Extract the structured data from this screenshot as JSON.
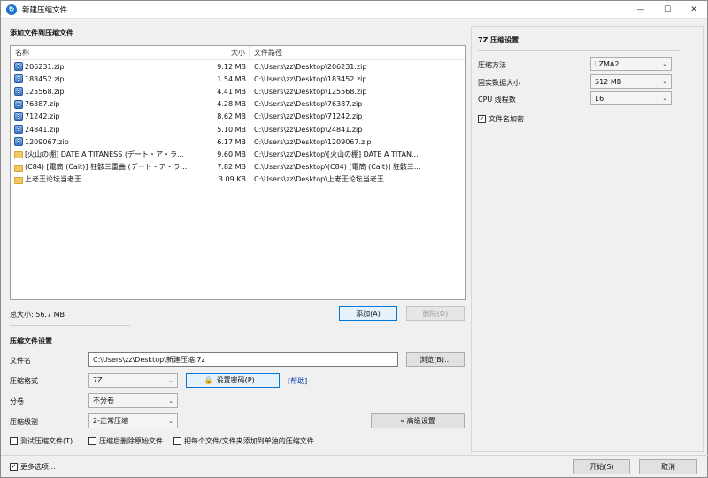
{
  "window": {
    "title": "新建压缩文件",
    "controls": {
      "minimize": "—",
      "maximize": "☐",
      "close": "✕"
    }
  },
  "add_files": {
    "section_title": "添加文件到压缩文件",
    "columns": {
      "name": "名称",
      "size": "大小",
      "path": "文件路径"
    },
    "rows": [
      {
        "icon": "zip-file-icon",
        "name": "206231.zip",
        "size": "9.12 MB",
        "path": "C:\\Users\\zz\\Desktop\\206231.zip"
      },
      {
        "icon": "zip-file-icon",
        "name": "183452.zip",
        "size": "1.54 MB",
        "path": "C:\\Users\\zz\\Desktop\\183452.zip"
      },
      {
        "icon": "zip-file-icon",
        "name": "125568.zip",
        "size": "4.41 MB",
        "path": "C:\\Users\\zz\\Desktop\\125568.zip"
      },
      {
        "icon": "zip-file-icon",
        "name": "76387.zip",
        "size": "4.28 MB",
        "path": "C:\\Users\\zz\\Desktop\\76387.zip"
      },
      {
        "icon": "zip-file-icon",
        "name": "71242.zip",
        "size": "8.62 MB",
        "path": "C:\\Users\\zz\\Desktop\\71242.zip"
      },
      {
        "icon": "zip-file-icon",
        "name": "24841.zip",
        "size": "5.10 MB",
        "path": "C:\\Users\\zz\\Desktop\\24841.zip"
      },
      {
        "icon": "zip-file-icon",
        "name": "1209067.zip",
        "size": "6.17 MB",
        "path": "C:\\Users\\zz\\Desktop\\1209067.zip"
      },
      {
        "icon": "folder-icon",
        "name": "[火山の棚] DATE A TITANESS (デート・ア・ラ...",
        "size": "9.60 MB",
        "path": "C:\\Users\\zz\\Desktop\\[火山の棚] DATE A TITAN..."
      },
      {
        "icon": "folder-icon",
        "name": "(C84) [電筒 (Cait)] 狂骸三重曲 (デート・ア・ラ...",
        "size": "7.82 MB",
        "path": "C:\\Users\\zz\\Desktop\\(C84) [電筒 (Cait)] 狂骸三..."
      },
      {
        "icon": "folder-icon",
        "name": "上老王论坛当老王",
        "size": "3.09 KB",
        "path": "C:\\Users\\zz\\Desktop\\上老王论坛当老王"
      }
    ],
    "total_size": "总大小: 56.7 MB",
    "add_button": "添加(A)",
    "delete_button": "删除(D)"
  },
  "settings": {
    "section_title": "压缩文件设置",
    "filename_label": "文件名",
    "filename_value": "C:\\Users\\zz\\Desktop\\新建压缩.7z",
    "browse_button": "浏览(B)...",
    "format_label": "压缩格式",
    "format_value": "7Z",
    "set_password_button": "设置密码(P)...",
    "help_link": "[帮助]",
    "split_label": "分卷",
    "split_value": "不分卷",
    "level_label": "压缩级别",
    "level_value": "2-正常压缩",
    "advanced_button": "« 高级设置",
    "options": [
      {
        "label": "测试压缩文件(T)",
        "checked": false
      },
      {
        "label": "压缩后删除原始文件",
        "checked": false
      },
      {
        "label": "把每个文件/文件夹添加到单独的压缩文件",
        "checked": false
      }
    ]
  },
  "sevenzip": {
    "section_title": "7Z 压缩设置",
    "method_label": "压缩方法",
    "method_value": "LZMA2",
    "dict_label": "固实数据大小",
    "dict_value": "512 MB",
    "threads_label": "CPU 线程数",
    "threads_value": "16",
    "encrypt_names_label": "文件名加密",
    "encrypt_names_checked": true
  },
  "footer": {
    "more_options_label": "更多选项...",
    "more_options_checked": true,
    "start_button": "开始(S)",
    "cancel_button": "取消"
  }
}
